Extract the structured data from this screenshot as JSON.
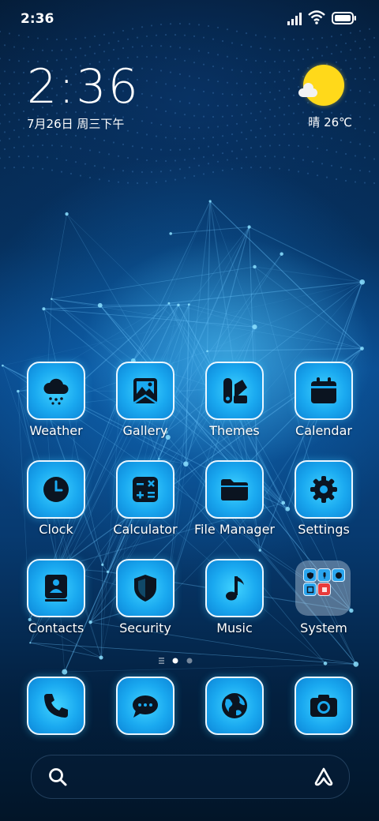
{
  "status_bar": {
    "time": "2:36",
    "icons": [
      "signal-icon",
      "wifi-icon",
      "battery-icon"
    ]
  },
  "clock_widget": {
    "time": "2:36",
    "date": "7月26日 周三下午"
  },
  "weather_widget": {
    "text": "晴 26℃",
    "icon": "sunny-cloud-icon"
  },
  "apps": [
    {
      "label": "Weather",
      "icon": "cloud-rain-icon"
    },
    {
      "label": "Gallery",
      "icon": "image-icon"
    },
    {
      "label": "Themes",
      "icon": "brush-icon"
    },
    {
      "label": "Calendar",
      "icon": "calendar-icon"
    },
    {
      "label": "Clock",
      "icon": "clock-icon"
    },
    {
      "label": "Calculator",
      "icon": "calculator-icon"
    },
    {
      "label": "File Manager",
      "icon": "folder-icon"
    },
    {
      "label": "Settings",
      "icon": "gear-icon"
    },
    {
      "label": "Contacts",
      "icon": "contacts-book-icon"
    },
    {
      "label": "Security",
      "icon": "shield-icon"
    },
    {
      "label": "Music",
      "icon": "music-note-icon"
    },
    {
      "label": "System",
      "icon": "system-folder-icon"
    }
  ],
  "page_indicator": {
    "pages": 2,
    "current": 1
  },
  "dock": [
    {
      "name": "phone",
      "icon": "phone-icon"
    },
    {
      "name": "messages",
      "icon": "message-icon"
    },
    {
      "name": "browser",
      "icon": "globe-icon"
    },
    {
      "name": "camera",
      "icon": "camera-icon"
    }
  ],
  "search_bar": {
    "icon": "search-icon",
    "assistant_icon": "assistant-icon"
  },
  "colors": {
    "icon_fill": "#1aa9f0",
    "icon_border": "#e9f6ff",
    "glyph": "#0b1420",
    "sun": "#ffd91a"
  }
}
